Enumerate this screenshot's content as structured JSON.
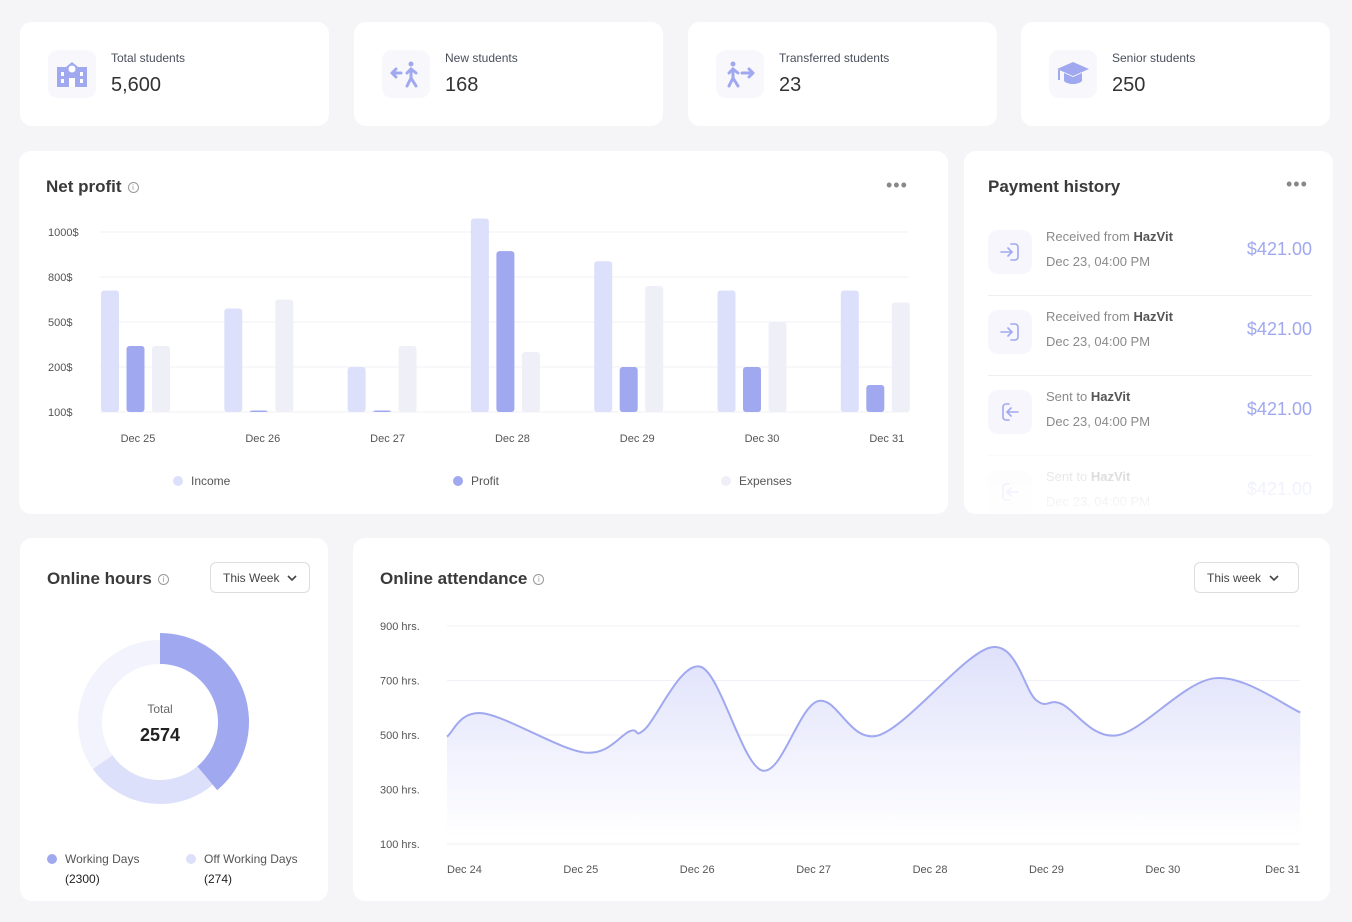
{
  "stats": [
    {
      "label": "Total students",
      "value": "5,600",
      "icon": "school-icon"
    },
    {
      "label": "New students",
      "value": "168",
      "icon": "walk-in-icon"
    },
    {
      "label": "Transferred students",
      "value": "23",
      "icon": "walk-out-icon"
    },
    {
      "label": "Senior students",
      "value": "250",
      "icon": "graduation-cap-icon"
    }
  ],
  "net_profit": {
    "title": "Net profit",
    "menu": "•••"
  },
  "payment": {
    "title": "Payment history",
    "menu": "•••",
    "items": [
      {
        "prefix": "Received from",
        "name": "HazVit",
        "date": "Dec 23, 04:00 PM",
        "amount": "$421.00",
        "icon": "login-icon"
      },
      {
        "prefix": "Received from",
        "name": "HazVit",
        "date": "Dec 23, 04:00 PM",
        "amount": "$421.00",
        "icon": "login-icon"
      },
      {
        "prefix": "Sent to",
        "name": "HazVit",
        "date": "Dec 23, 04:00 PM",
        "amount": "$421.00",
        "icon": "logout-icon"
      },
      {
        "prefix": "Sent to",
        "name": "HazVit",
        "date": "Dec 23, 04:00 PM",
        "amount": "$421.00",
        "icon": "logout-icon"
      }
    ]
  },
  "online_hours": {
    "title": "Online hours",
    "filter": "This Week",
    "center_label": "Total",
    "total": "2574",
    "legend": [
      {
        "label": "Working Days",
        "value": "(2300)",
        "color": "#a0a8ef"
      },
      {
        "label": "Off Working Days",
        "value": "(274)",
        "color": "#dde0fb"
      }
    ]
  },
  "attendance": {
    "title": "Online attendance",
    "filter": "This week"
  },
  "colors": {
    "accent": "#a0a8ef",
    "income": "#dde0fb",
    "expenses": "#efeff8",
    "background": "#f5f5f7"
  },
  "chart_data": [
    {
      "type": "bar",
      "categories": [
        "Dec 25",
        "Dec 26",
        "Dec 27",
        "Dec 28",
        "Dec 29",
        "Dec 30",
        "Dec 31"
      ],
      "yticks": [
        "100$",
        "200$",
        "500$",
        "800$",
        "1000$"
      ],
      "ytick_values": [
        100,
        200,
        500,
        800,
        1000
      ],
      "grid": true,
      "legend_placement": "bottom",
      "series": [
        {
          "name": "Income",
          "color": "#dde0fb",
          "values": [
            710,
            590,
            200,
            1060,
            870,
            710,
            710
          ]
        },
        {
          "name": "Profit",
          "color": "#a0a8ef",
          "values": [
            340,
            100,
            100,
            915,
            200,
            200,
            160
          ]
        },
        {
          "name": "Expenses",
          "color": "#efeff8",
          "values": [
            340,
            650,
            340,
            300,
            740,
            500,
            630
          ]
        }
      ]
    },
    {
      "type": "area",
      "xticks": [
        "Dec 24",
        "Dec 25",
        "Dec 26",
        "Dec 27",
        "Dec 28",
        "Dec 29",
        "Dec 30",
        "Dec 31"
      ],
      "yticks": [
        "900 hrs.",
        "700 hrs.",
        "500 hrs.",
        "300 hrs.",
        "100 hrs."
      ],
      "ylim": [
        100,
        900
      ],
      "grid": true,
      "points": [
        [
          "Dec 24 00:00",
          494
        ],
        [
          "Dec 24 07:00",
          580
        ],
        [
          "Dec 25 03:00",
          436
        ],
        [
          "Dec 25 12:00",
          514
        ],
        [
          "Dec 25 15:00",
          522
        ],
        [
          "Dec 26 02:00",
          750
        ],
        [
          "Dec 26 14:00",
          370
        ],
        [
          "Dec 27 01:00",
          624
        ],
        [
          "Dec 27 13:00",
          499
        ],
        [
          "Dec 28 11:00",
          821
        ],
        [
          "Dec 28 20:00",
          628
        ],
        [
          "Dec 29 01:00",
          614
        ],
        [
          "Dec 29 12:00",
          499
        ],
        [
          "Dec 30 07:00",
          708
        ],
        [
          "Dec 31 00:00",
          583
        ]
      ]
    }
  ]
}
